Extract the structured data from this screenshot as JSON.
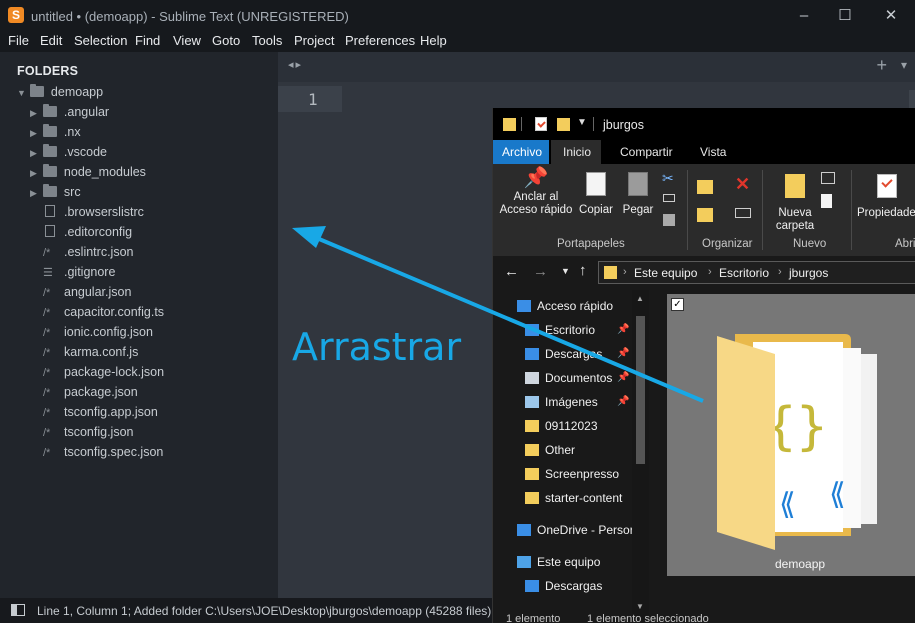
{
  "app": {
    "title": "untitled • (demoapp) - Sublime Text (UNREGISTERED)",
    "window_controls": [
      "minimize",
      "maximize",
      "close"
    ]
  },
  "menu": [
    "File",
    "Edit",
    "Selection",
    "Find",
    "View",
    "Goto",
    "Tools",
    "Project",
    "Preferences",
    "Help"
  ],
  "sidebar": {
    "header": "FOLDERS",
    "root": "demoapp",
    "items": [
      {
        "label": ".angular",
        "icon": "folder-icon"
      },
      {
        "label": ".nx",
        "icon": "folder-icon"
      },
      {
        "label": ".vscode",
        "icon": "folder-icon"
      },
      {
        "label": "node_modules",
        "icon": "folder-icon"
      },
      {
        "label": "src",
        "icon": "folder-icon"
      },
      {
        "label": ".browserslistrc",
        "icon": "file-icon"
      },
      {
        "label": ".editorconfig",
        "icon": "file-icon"
      },
      {
        "label": ".eslintrc.json",
        "icon": "code-file-icon"
      },
      {
        "label": ".gitignore",
        "icon": "list-file-icon"
      },
      {
        "label": "angular.json",
        "icon": "code-file-icon"
      },
      {
        "label": "capacitor.config.ts",
        "icon": "code-file-icon"
      },
      {
        "label": "ionic.config.json",
        "icon": "code-file-icon"
      },
      {
        "label": "karma.conf.js",
        "icon": "code-file-icon"
      },
      {
        "label": "package-lock.json",
        "icon": "code-file-icon"
      },
      {
        "label": "package.json",
        "icon": "code-file-icon"
      },
      {
        "label": "tsconfig.app.json",
        "icon": "code-file-icon"
      },
      {
        "label": "tsconfig.json",
        "icon": "code-file-icon"
      },
      {
        "label": "tsconfig.spec.json",
        "icon": "code-file-icon"
      }
    ]
  },
  "editor": {
    "line_number": "1",
    "nav_arrows": "◂▸",
    "plus": "+",
    "chevron": "▾"
  },
  "status": "Line 1, Column 1; Added folder C:\\Users\\JOE\\Desktop\\jburgos\\demoapp (45288 files)",
  "annotation": {
    "text": "Arrastrar",
    "color": "#18a8e6"
  },
  "explorer": {
    "title": "jburgos",
    "tabs": [
      "Archivo",
      "Inicio",
      "Compartir",
      "Vista"
    ],
    "ribbon": {
      "pin_label_1": "Anclar al",
      "pin_label_2": "Acceso rápido",
      "copy": "Copiar",
      "paste": "Pegar",
      "new_folder_1": "Nueva",
      "new_folder_2": "carpeta",
      "properties": "Propiedades",
      "group_clipboard": "Portapapeles",
      "group_organize": "Organizar",
      "group_new": "Nuevo",
      "group_open": "Abri"
    },
    "breadcrumb": [
      "Este equipo",
      "Escritorio",
      "jburgos"
    ],
    "nav": [
      {
        "label": "Acceso rápido",
        "icon": "star-icon",
        "pinned": false
      },
      {
        "label": "Escritorio",
        "icon": "desktop-icon",
        "pinned": true
      },
      {
        "label": "Descargas",
        "icon": "download-icon",
        "pinned": true
      },
      {
        "label": "Documentos",
        "icon": "documents-icon",
        "pinned": true
      },
      {
        "label": "Imágenes",
        "icon": "images-icon",
        "pinned": true
      },
      {
        "label": "09112023",
        "icon": "folder-icon",
        "pinned": false
      },
      {
        "label": "Other",
        "icon": "folder-icon",
        "pinned": false
      },
      {
        "label": "Screenpresso",
        "icon": "folder-icon",
        "pinned": false
      },
      {
        "label": "starter-content",
        "icon": "folder-icon",
        "pinned": false
      },
      {
        "label": "OneDrive - Persor",
        "icon": "onedrive-icon",
        "pinned": false
      },
      {
        "label": "Este equipo",
        "icon": "computer-icon",
        "pinned": false
      },
      {
        "label": "Descargas",
        "icon": "download-icon",
        "pinned": false
      }
    ],
    "selected_item": "demoapp",
    "status_left": "1 elemento",
    "status_right": "1 elemento seleccionado"
  }
}
